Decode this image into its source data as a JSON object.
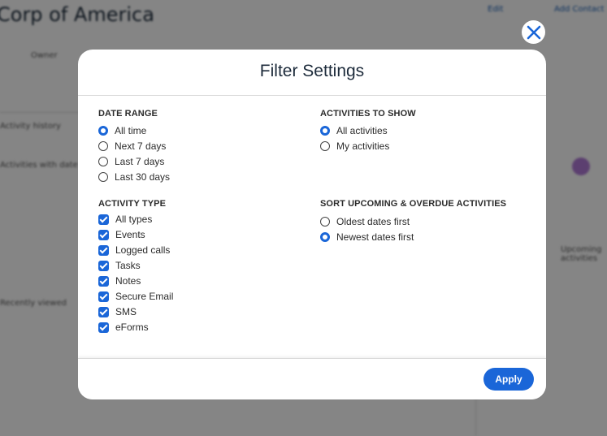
{
  "background": {
    "title": "Corp of America",
    "top_links": [
      "",
      "Edit",
      "Add Contact"
    ],
    "labels": [
      "Owner",
      "Activity history",
      "Activities with date",
      "Recently viewed",
      "Upcoming activities"
    ]
  },
  "modal": {
    "title": "Filter Settings",
    "date_range": {
      "title": "DATE RANGE",
      "options": [
        {
          "label": "All time",
          "selected": true
        },
        {
          "label": "Next 7 days",
          "selected": false
        },
        {
          "label": "Last 7 days",
          "selected": false
        },
        {
          "label": "Last 30 days",
          "selected": false
        }
      ]
    },
    "activities_to_show": {
      "title": "ACTIVITIES TO SHOW",
      "options": [
        {
          "label": "All activities",
          "selected": true
        },
        {
          "label": "My activities",
          "selected": false
        }
      ]
    },
    "activity_type": {
      "title": "ACTIVITY TYPE",
      "options": [
        {
          "label": "All types",
          "checked": true
        },
        {
          "label": "Events",
          "checked": true
        },
        {
          "label": "Logged calls",
          "checked": true
        },
        {
          "label": "Tasks",
          "checked": true
        },
        {
          "label": "Notes",
          "checked": true
        },
        {
          "label": "Secure Email",
          "checked": true
        },
        {
          "label": "SMS",
          "checked": true
        },
        {
          "label": "eForms",
          "checked": true
        }
      ]
    },
    "sort": {
      "title": "SORT UPCOMING & OVERDUE ACTIVITIES",
      "options": [
        {
          "label": "Oldest dates first",
          "selected": false
        },
        {
          "label": "Newest dates first",
          "selected": true
        }
      ]
    },
    "apply_label": "Apply"
  },
  "colors": {
    "accent": "#1a66d8",
    "overlay": "rgba(0,0,0,0.48)"
  },
  "icons": {
    "close": "close-icon"
  }
}
